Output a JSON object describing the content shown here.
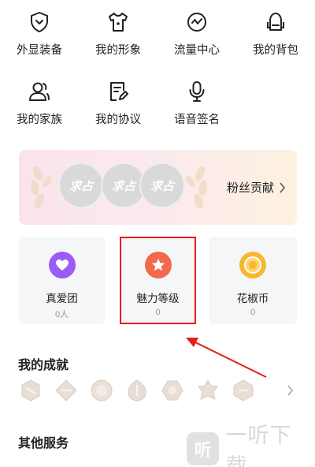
{
  "menu": {
    "row1": [
      {
        "label": "外显装备",
        "icon": "shield-icon"
      },
      {
        "label": "我的形象",
        "icon": "tshirt-icon"
      },
      {
        "label": "流量中心",
        "icon": "wave-circle-icon"
      },
      {
        "label": "我的背包",
        "icon": "backpack-icon"
      }
    ],
    "row2": [
      {
        "label": "我的家族",
        "icon": "family-icon"
      },
      {
        "label": "我的协议",
        "icon": "document-edit-icon"
      },
      {
        "label": "语音签名",
        "icon": "microphone-icon"
      }
    ]
  },
  "fans": {
    "badges": [
      "求占",
      "求占",
      "求占"
    ],
    "link_label": "粉丝贡献"
  },
  "cards": [
    {
      "title": "真爱团",
      "value": "0人",
      "icon": "heart-hands-icon",
      "color": "#9b5cf6"
    },
    {
      "title": "魅力等级",
      "value": "0",
      "icon": "star-icon",
      "color": "#f26a4b"
    },
    {
      "title": "花椒币",
      "value": "0",
      "icon": "coin-icon",
      "color": "#f7b733"
    }
  ],
  "achievements": {
    "title": "我的成就",
    "count": 7
  },
  "other_services": {
    "title": "其他服务"
  },
  "annotation": {
    "highlight_color": "#e81c1c"
  },
  "watermark": {
    "logo_char": "听",
    "text": "一听下载"
  }
}
